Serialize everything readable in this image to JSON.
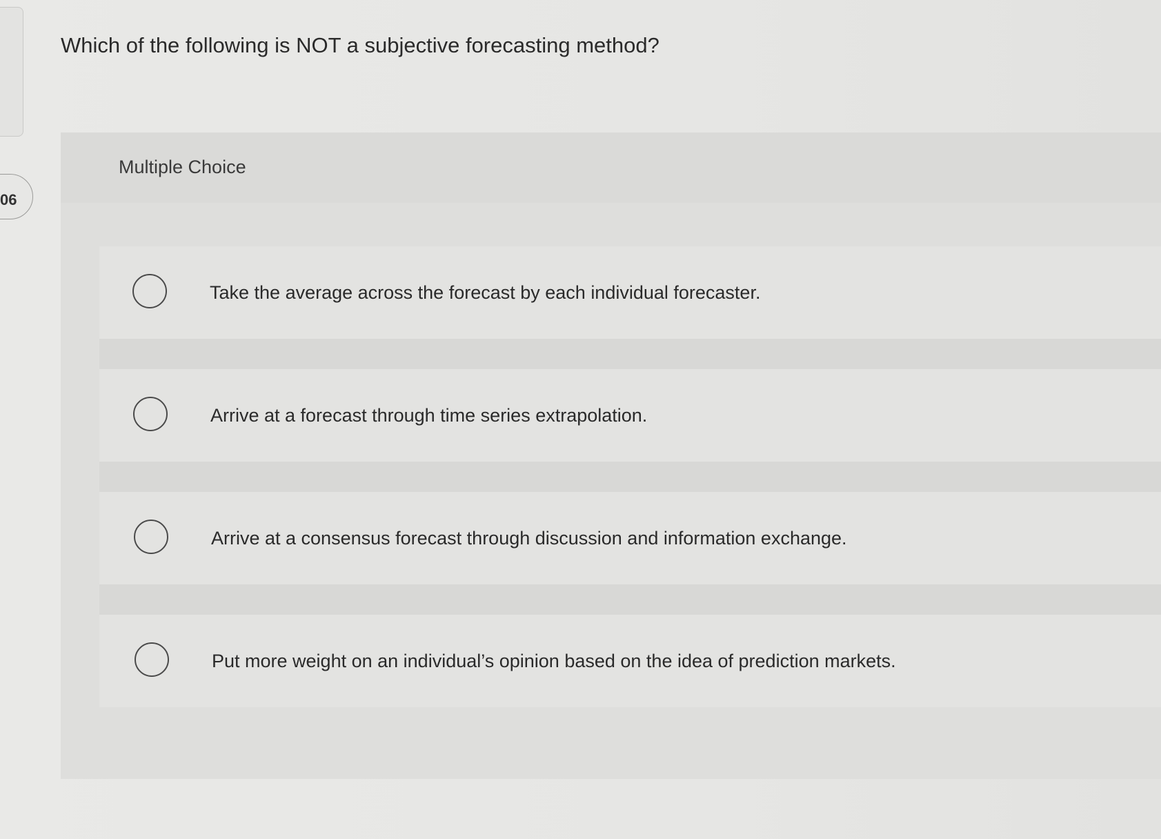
{
  "question_number": "06",
  "question": {
    "text": "Which of the following is NOT a subjective forecasting method?"
  },
  "answer_block": {
    "label": "Multiple Choice",
    "options": [
      {
        "text": "Take the average across the forecast by each individual forecaster.",
        "selected": false
      },
      {
        "text": "Arrive at a forecast through time series extrapolation.",
        "selected": false
      },
      {
        "text": "Arrive at a consensus forecast through discussion and information exchange.",
        "selected": false
      },
      {
        "text": "Put more weight on an individual’s opinion based on the idea of prediction markets.",
        "selected": false
      }
    ]
  }
}
